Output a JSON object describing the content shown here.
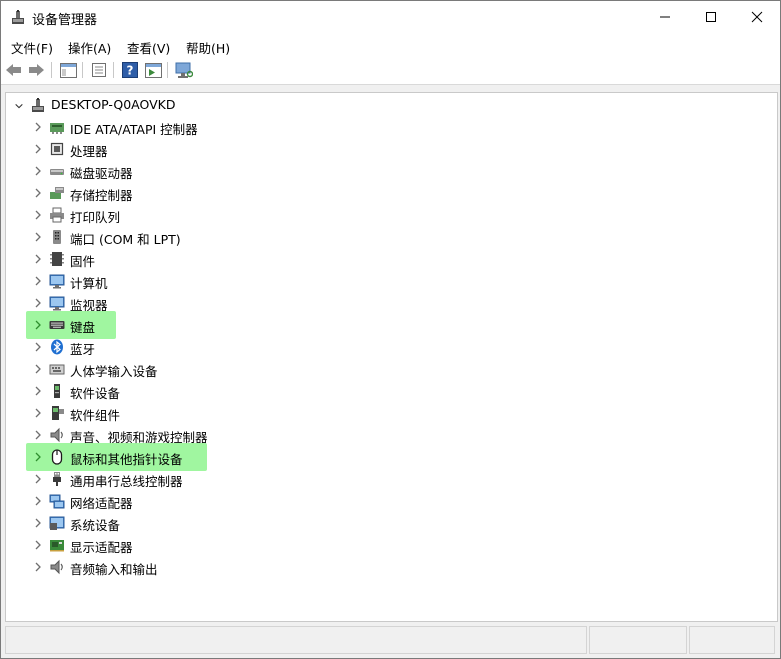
{
  "window": {
    "title": "设备管理器",
    "app_icon": "device-manager-icon"
  },
  "menu": [
    {
      "label": "文件(F)"
    },
    {
      "label": "操作(A)"
    },
    {
      "label": "查看(V)"
    },
    {
      "label": "帮助(H)"
    }
  ],
  "tree": {
    "root": {
      "label": "DESKTOP-Q0AOVKD",
      "icon": "computer-icon",
      "expanded": true
    },
    "items": [
      {
        "label": "IDE ATA/ATAPI 控制器",
        "icon": "ide-controller-icon",
        "highlighted": false
      },
      {
        "label": "处理器",
        "icon": "processor-icon",
        "highlighted": false
      },
      {
        "label": "磁盘驱动器",
        "icon": "disk-drive-icon",
        "highlighted": false
      },
      {
        "label": "存储控制器",
        "icon": "storage-controller-icon",
        "highlighted": false
      },
      {
        "label": "打印队列",
        "icon": "printer-icon",
        "highlighted": false
      },
      {
        "label": "端口 (COM 和 LPT)",
        "icon": "port-icon",
        "highlighted": false
      },
      {
        "label": "固件",
        "icon": "firmware-icon",
        "highlighted": false
      },
      {
        "label": "计算机",
        "icon": "monitor-icon",
        "highlighted": false
      },
      {
        "label": "监视器",
        "icon": "monitor-icon",
        "highlighted": false
      },
      {
        "label": "键盘",
        "icon": "keyboard-icon",
        "highlighted": true
      },
      {
        "label": "蓝牙",
        "icon": "bluetooth-icon",
        "highlighted": false
      },
      {
        "label": "人体学输入设备",
        "icon": "hid-icon",
        "highlighted": false
      },
      {
        "label": "软件设备",
        "icon": "software-device-icon",
        "highlighted": false
      },
      {
        "label": "软件组件",
        "icon": "software-component-icon",
        "highlighted": false
      },
      {
        "label": "声音、视频和游戏控制器",
        "icon": "speaker-icon",
        "highlighted": false
      },
      {
        "label": "鼠标和其他指针设备",
        "icon": "mouse-icon",
        "highlighted": true
      },
      {
        "label": "通用串行总线控制器",
        "icon": "usb-icon",
        "highlighted": false
      },
      {
        "label": "网络适配器",
        "icon": "network-adapter-icon",
        "highlighted": false
      },
      {
        "label": "系统设备",
        "icon": "system-device-icon",
        "highlighted": false
      },
      {
        "label": "显示适配器",
        "icon": "display-adapter-icon",
        "highlighted": false
      },
      {
        "label": "音频输入和输出",
        "icon": "speaker-icon",
        "highlighted": false
      }
    ]
  },
  "colors": {
    "highlight": "#8ff58f",
    "link_blue": "#1f6fd1",
    "chevron": "#6f6f6f"
  }
}
